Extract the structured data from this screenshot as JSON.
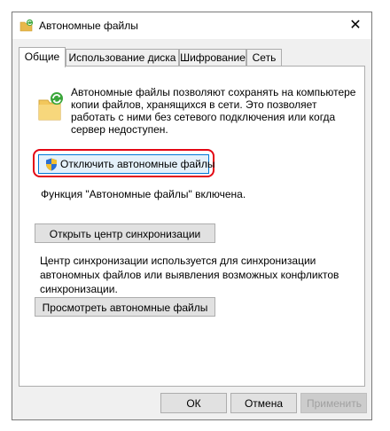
{
  "window": {
    "title": "Автономные файлы",
    "close_glyph": "✕"
  },
  "tabs": [
    {
      "label": "Общие",
      "active": true
    },
    {
      "label": "Использование диска",
      "active": false
    },
    {
      "label": "Шифрование",
      "active": false
    },
    {
      "label": "Сеть",
      "active": false
    }
  ],
  "general": {
    "description": "Автономные файлы позволяют сохранять на компьютере копии файлов, хранящихся в сети.  Это позволяет работать с ними без сетевого подключения или когда сервер недоступен.",
    "disable_button": "Отключить автономные файлы",
    "status_text": "Функция \"Автономные файлы\" включена.",
    "sync_center_button": "Открыть центр синхронизации",
    "sync_description": "Центр синхронизации используется для синхронизации автономных файлов или выявления возможных конфликтов синхронизации.",
    "view_files_button": "Просмотреть автономные файлы"
  },
  "footer": {
    "ok": "ОК",
    "cancel": "Отмена",
    "apply": "Применить"
  },
  "colors": {
    "highlight": "#e30613",
    "focus_border": "#0078d7",
    "panel_bg": "#ffffff",
    "dialog_bg": "#f0f0f0"
  },
  "icons": {
    "app": "offline-files-icon",
    "close": "close-icon",
    "folder": "sync-folder-icon",
    "shield": "uac-shield-icon"
  }
}
